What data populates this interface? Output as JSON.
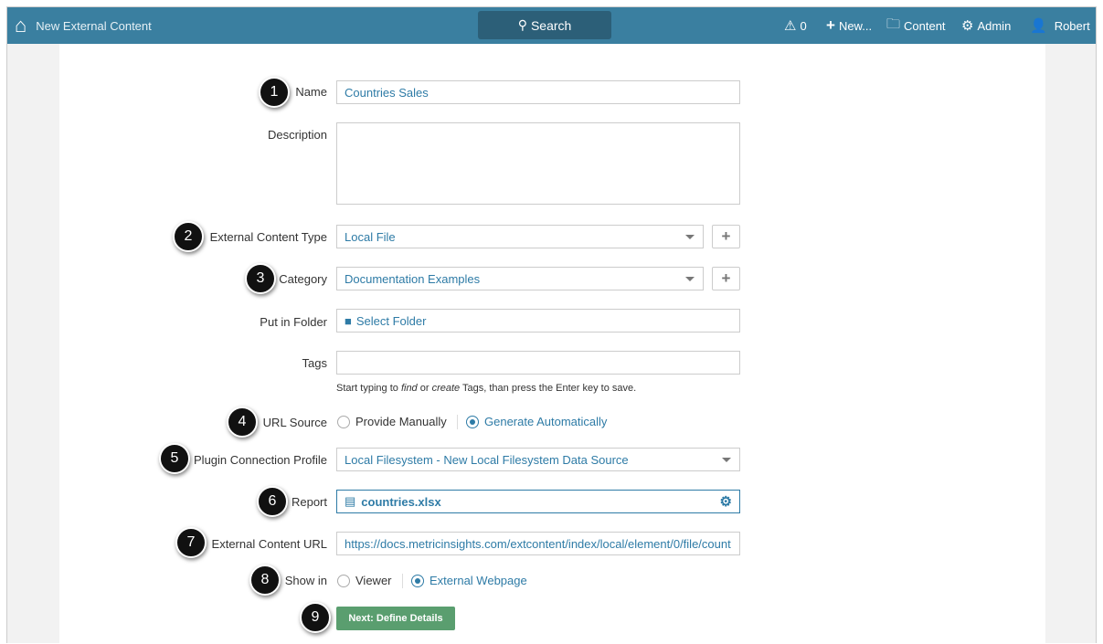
{
  "topbar": {
    "title": "New External Content",
    "search": "Search",
    "alerts": "0",
    "new": "New...",
    "content": "Content",
    "admin": "Admin",
    "user": "Robert"
  },
  "form": {
    "name_label": "Name",
    "name_value": "Countries Sales",
    "description_label": "Description",
    "description_value": "",
    "type_label": "External Content Type",
    "type_value": "Local File",
    "category_label": "Category",
    "category_value": "Documentation Examples",
    "folder_label": "Put in Folder",
    "folder_value": "Select Folder",
    "tags_label": "Tags",
    "tags_value": "",
    "tags_hint_1": "Start typing to ",
    "tags_hint_find": "find",
    "tags_hint_2": " or ",
    "tags_hint_create": "create",
    "tags_hint_3": " Tags, than press the Enter key to save.",
    "url_source_label": "URL Source",
    "url_source_options": [
      "Provide Manually",
      "Generate Automatically"
    ],
    "url_source_selected": "Generate Automatically",
    "profile_label": "Plugin Connection Profile",
    "profile_value": "Local Filesystem - New Local Filesystem Data Source",
    "report_label": "Report",
    "report_value": "countries.xlsx",
    "url_label": "External Content URL",
    "url_value": "https://docs.metricinsights.com/extcontent/index/local/element/0/file/count",
    "show_in_label": "Show in",
    "show_in_options": [
      "Viewer",
      "External Webpage"
    ],
    "show_in_selected": "External Webpage",
    "next_button": "Next: Define Details"
  },
  "annotations": [
    "1",
    "2",
    "3",
    "4",
    "5",
    "6",
    "7",
    "8",
    "9"
  ],
  "colors": {
    "topbar": "#3a7fa0",
    "accent": "#2e7ba6",
    "button": "#5a9e6f"
  }
}
